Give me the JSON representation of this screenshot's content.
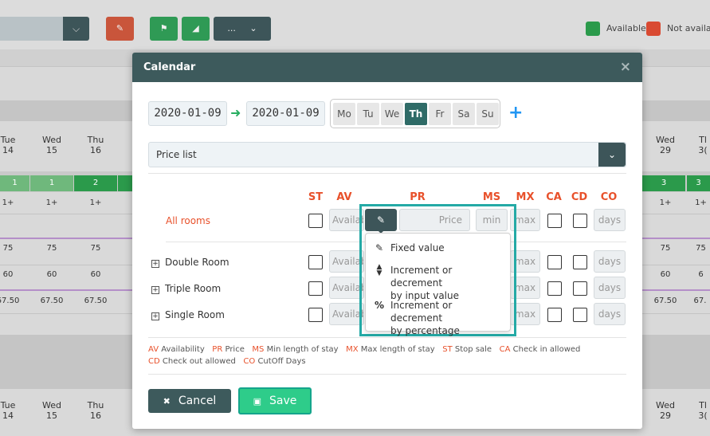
{
  "background": {
    "legend": {
      "available": "Available",
      "not_available": "Not availab",
      "available_color": "#2b9a4b",
      "not_available_color": "#d94a32"
    },
    "toolbar": {
      "more_label": "..."
    },
    "left_columns": [
      {
        "day": "Tue",
        "date": "14"
      },
      {
        "day": "Wed",
        "date": "15"
      },
      {
        "day": "Thu",
        "date": "16"
      }
    ],
    "right_columns": [
      {
        "day": "Wed",
        "date": "29"
      },
      {
        "day": "Tl",
        "date": "3("
      }
    ],
    "left_availability": [
      "1",
      "1",
      "2"
    ],
    "right_availability": [
      "3",
      "3"
    ],
    "left_min": [
      "1+",
      "1+",
      "1+"
    ],
    "right_min": [
      "1+",
      "1+"
    ],
    "left_price_a": [
      "75",
      "75",
      "75"
    ],
    "right_price_a": [
      "75",
      "75"
    ],
    "left_price_b": [
      "60",
      "60",
      "60"
    ],
    "right_price_b": [
      "60",
      "6"
    ],
    "left_price_c": [
      "67.50",
      "67.50",
      "67.50"
    ],
    "right_price_c": [
      "67.50",
      "67."
    ]
  },
  "modal": {
    "title": "Calendar",
    "close_label": "×",
    "date_from": "2020-01-09",
    "date_to": "2020-01-09",
    "weekdays": [
      "Mo",
      "Tu",
      "We",
      "Th",
      "Fr",
      "Sa",
      "Su"
    ],
    "active_weekday": "Th",
    "add_label": "+",
    "price_list_label": "Price list",
    "columns": [
      "ST",
      "AV",
      "PR",
      "MS",
      "MX",
      "CA",
      "CD",
      "CO"
    ],
    "rows": [
      {
        "label": "All rooms",
        "expandable": false
      },
      {
        "label": "Double Room",
        "expandable": true
      },
      {
        "label": "Triple Room",
        "expandable": true
      },
      {
        "label": "Single Room",
        "expandable": true
      }
    ],
    "placeholders": {
      "availability": "Availability",
      "price": "Price",
      "min": "min",
      "max": "max",
      "days": "days"
    },
    "legend_line1": [
      {
        "code": "AV",
        "text": "Availability"
      },
      {
        "code": "PR",
        "text": "Price"
      },
      {
        "code": "MS",
        "text": "Min length of stay"
      },
      {
        "code": "MX",
        "text": "Max length of stay"
      },
      {
        "code": "ST",
        "text": "Stop sale"
      },
      {
        "code": "CA",
        "text": "Check in allowed"
      }
    ],
    "legend_line2": [
      {
        "code": "CD",
        "text": "Check out allowed"
      },
      {
        "code": "CO",
        "text": "CutOff Days"
      }
    ],
    "cancel_label": "Cancel",
    "save_label": "Save",
    "price_menu": {
      "items": [
        {
          "icon": "pencil-icon",
          "line1": "Fixed value",
          "line2": ""
        },
        {
          "icon": "sort-icon",
          "line1": "Increment or decrement",
          "line2": "by input value"
        },
        {
          "icon": "percent-icon",
          "line1": "Increment or decrement",
          "line2": "by percentage"
        }
      ]
    }
  }
}
